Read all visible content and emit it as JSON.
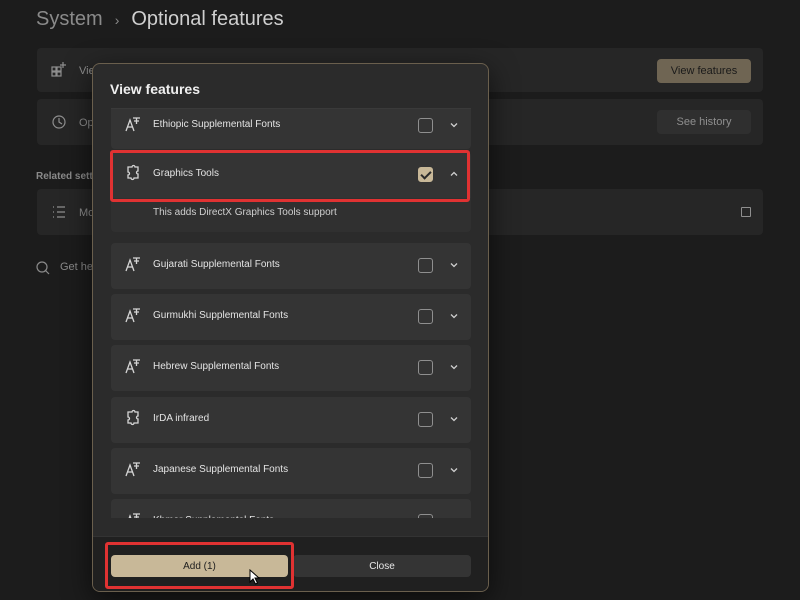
{
  "breadcrumb": {
    "parent": "System",
    "separator": "›",
    "current": "Optional features"
  },
  "background": {
    "card1_text": "Vie",
    "card1_button": "View features",
    "card2_text": "Op",
    "card2_button": "See history",
    "related_heading": "Related sett",
    "card3_text": "Mo",
    "get_help": "Get hel"
  },
  "dialog": {
    "title": "View features",
    "features": [
      {
        "label": "Ethiopic Supplemental Fonts",
        "icon": "font-icon",
        "checked": false,
        "expanded": false
      },
      {
        "label": "Graphics Tools",
        "icon": "puzzle-icon",
        "checked": true,
        "expanded": true,
        "description": "This adds DirectX Graphics Tools support"
      },
      {
        "label": "Gujarati Supplemental Fonts",
        "icon": "font-icon",
        "checked": false,
        "expanded": false
      },
      {
        "label": "Gurmukhi Supplemental Fonts",
        "icon": "font-icon",
        "checked": false,
        "expanded": false
      },
      {
        "label": "Hebrew Supplemental Fonts",
        "icon": "font-icon",
        "checked": false,
        "expanded": false
      },
      {
        "label": "IrDA infrared",
        "icon": "puzzle-icon",
        "checked": false,
        "expanded": false
      },
      {
        "label": "Japanese Supplemental Fonts",
        "icon": "font-icon",
        "checked": false,
        "expanded": false
      },
      {
        "label": "Khmer Supplemental Fonts",
        "icon": "font-icon",
        "checked": false,
        "expanded": false
      }
    ],
    "add_button": "Add (1)",
    "close_button": "Close"
  },
  "colors": {
    "accent": "#c8b898",
    "highlight": "#e03232"
  }
}
